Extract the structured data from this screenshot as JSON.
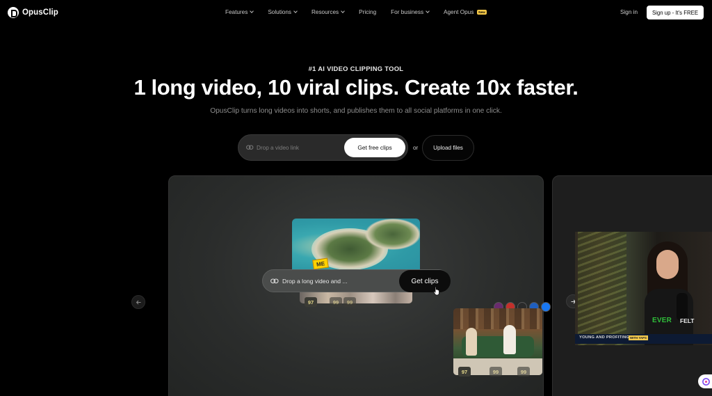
{
  "nav": {
    "logo_text": "OpusClip",
    "links": [
      {
        "label": "Features",
        "dropdown": true
      },
      {
        "label": "Solutions",
        "dropdown": true
      },
      {
        "label": "Resources",
        "dropdown": true
      },
      {
        "label": "Pricing",
        "dropdown": false
      },
      {
        "label": "For business",
        "dropdown": true
      },
      {
        "label": "Agent Opus",
        "dropdown": false,
        "badge": "New"
      }
    ],
    "signin": "Sign in",
    "signup": "Sign up - It's FREE"
  },
  "hero": {
    "eyebrow": "#1 AI VIDEO CLIPPING TOOL",
    "headline": "1 long video, 10 viral clips. Create 10x faster.",
    "subline": "OpusClip turns long videos into shorts, and publishes them to all social platforms in one click.",
    "input_placeholder": "Drop a video link",
    "cta": "Get free clips",
    "or": "or",
    "upload": "Upload files"
  },
  "demo": {
    "sticker": "ME",
    "input_placeholder": "Drop a long video and ...",
    "button": "Get clips",
    "scores": [
      "97",
      "99",
      "99",
      "97",
      "99",
      "99"
    ],
    "prev_icon": "arrow-left-icon",
    "next_icon": "arrow-right-icon"
  },
  "side": {
    "ever": "EVER",
    "felt": "FELT",
    "show_title": "YOUNG AND PROFITING",
    "tag": "WITH YAPS"
  },
  "colors": {
    "background": "#000000",
    "badge_yellow": "#f7c948",
    "score_text": "#e4d88a",
    "caption_green": "#2fbf3a"
  }
}
